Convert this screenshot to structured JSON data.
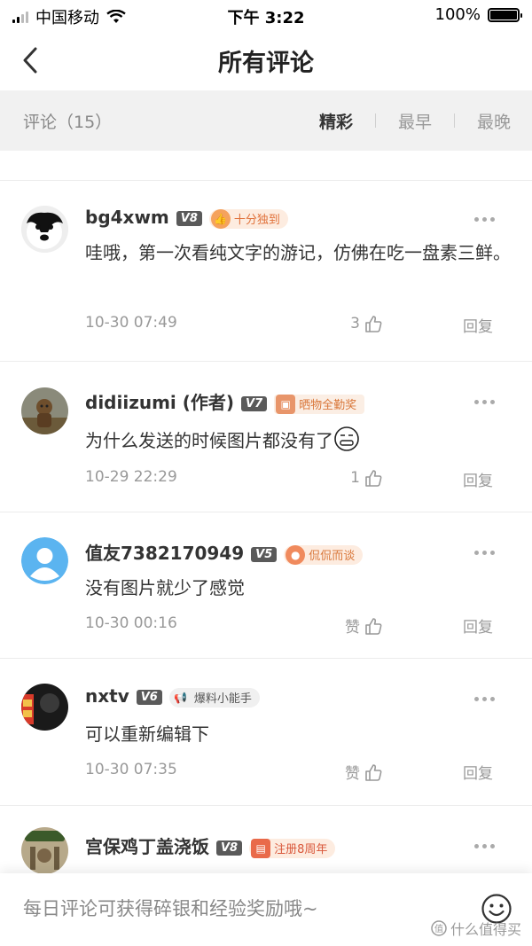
{
  "status_bar": {
    "carrier": "中国移动",
    "time": "下午 3:22",
    "battery": "100%"
  },
  "nav": {
    "title": "所有评论"
  },
  "filter": {
    "count_label": "评论（15）",
    "sorts": [
      "精彩",
      "最早",
      "最晚"
    ],
    "active_sort": "精彩"
  },
  "comments": [
    {
      "username": "bg4xwm",
      "level": "V8",
      "badge": "十分独到",
      "badge_icon": "thumbs-up-icon",
      "text": "哇哦，第一次看纯文字的游记，仿佛在吃一盘素三鲜。",
      "date": "10-30 07:49",
      "likes": "3",
      "reply": "回复"
    },
    {
      "username": "didiizumi (作者)",
      "level": "V7",
      "badge": "晒物全勤奖",
      "badge_icon": "camera-icon",
      "text": "为什么发送的时候图片都没有了",
      "date": "10-29 22:29",
      "likes": "1",
      "reply": "回复"
    },
    {
      "username": "值友7382170949",
      "level": "V5",
      "badge": "侃侃而谈",
      "badge_icon": "chat-icon",
      "text": "没有图片就少了感觉",
      "date": "10-30 00:16",
      "likes": "赞",
      "reply": "回复"
    },
    {
      "username": "nxtv",
      "level": "V6",
      "badge": "爆料小能手",
      "badge_icon": "megaphone-icon",
      "text": "可以重新编辑下",
      "date": "10-30 07:35",
      "likes": "赞",
      "reply": "回复"
    },
    {
      "username": "宫保鸡丁盖浇饭",
      "level": "V8",
      "badge": "注册8周年",
      "badge_icon": "cake-icon",
      "text": "",
      "date": "",
      "likes": "",
      "reply": ""
    }
  ],
  "bottom": {
    "placeholder": "每日评论可获得碎银和经验奖励哦~",
    "watermark": "什么值得买"
  },
  "colors": {
    "badge_orange": "#f5a25d",
    "badge_bg": "#fdf0e6",
    "badge_text": "#e0803f",
    "level_bg": "#5a5a5a"
  }
}
